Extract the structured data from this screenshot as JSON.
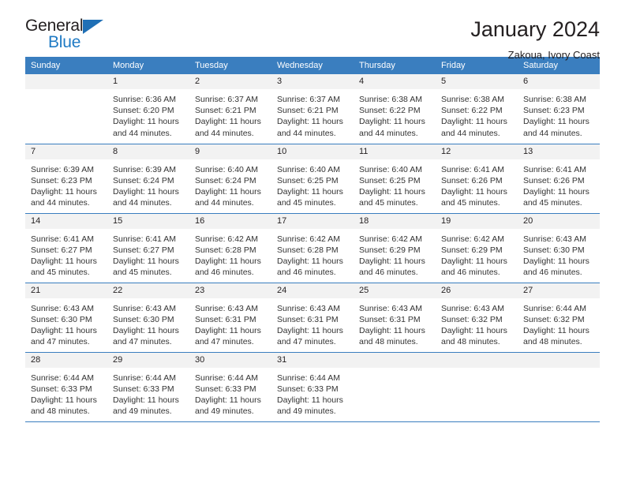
{
  "brand": {
    "name_part1": "General",
    "name_part2": "Blue",
    "triangle_color": "#1f6fb5",
    "blue_color": "#1f7ac4"
  },
  "header": {
    "title": "January 2024",
    "subtitle": "Zakoua, Ivory Coast"
  },
  "theme": {
    "header_row_bg": "#3a7ebf",
    "daynum_bg": "#f2f2f2",
    "row_border": "#3a7ebf",
    "text": "#231f20"
  },
  "weekday_headers": [
    "Sunday",
    "Monday",
    "Tuesday",
    "Wednesday",
    "Thursday",
    "Friday",
    "Saturday"
  ],
  "weeks": [
    [
      {
        "day": "",
        "sunrise": "",
        "sunset": "",
        "daylight_line1": "",
        "daylight_line2": ""
      },
      {
        "day": "1",
        "sunrise": "Sunrise: 6:36 AM",
        "sunset": "Sunset: 6:20 PM",
        "daylight_line1": "Daylight: 11 hours",
        "daylight_line2": "and 44 minutes."
      },
      {
        "day": "2",
        "sunrise": "Sunrise: 6:37 AM",
        "sunset": "Sunset: 6:21 PM",
        "daylight_line1": "Daylight: 11 hours",
        "daylight_line2": "and 44 minutes."
      },
      {
        "day": "3",
        "sunrise": "Sunrise: 6:37 AM",
        "sunset": "Sunset: 6:21 PM",
        "daylight_line1": "Daylight: 11 hours",
        "daylight_line2": "and 44 minutes."
      },
      {
        "day": "4",
        "sunrise": "Sunrise: 6:38 AM",
        "sunset": "Sunset: 6:22 PM",
        "daylight_line1": "Daylight: 11 hours",
        "daylight_line2": "and 44 minutes."
      },
      {
        "day": "5",
        "sunrise": "Sunrise: 6:38 AM",
        "sunset": "Sunset: 6:22 PM",
        "daylight_line1": "Daylight: 11 hours",
        "daylight_line2": "and 44 minutes."
      },
      {
        "day": "6",
        "sunrise": "Sunrise: 6:38 AM",
        "sunset": "Sunset: 6:23 PM",
        "daylight_line1": "Daylight: 11 hours",
        "daylight_line2": "and 44 minutes."
      }
    ],
    [
      {
        "day": "7",
        "sunrise": "Sunrise: 6:39 AM",
        "sunset": "Sunset: 6:23 PM",
        "daylight_line1": "Daylight: 11 hours",
        "daylight_line2": "and 44 minutes."
      },
      {
        "day": "8",
        "sunrise": "Sunrise: 6:39 AM",
        "sunset": "Sunset: 6:24 PM",
        "daylight_line1": "Daylight: 11 hours",
        "daylight_line2": "and 44 minutes."
      },
      {
        "day": "9",
        "sunrise": "Sunrise: 6:40 AM",
        "sunset": "Sunset: 6:24 PM",
        "daylight_line1": "Daylight: 11 hours",
        "daylight_line2": "and 44 minutes."
      },
      {
        "day": "10",
        "sunrise": "Sunrise: 6:40 AM",
        "sunset": "Sunset: 6:25 PM",
        "daylight_line1": "Daylight: 11 hours",
        "daylight_line2": "and 45 minutes."
      },
      {
        "day": "11",
        "sunrise": "Sunrise: 6:40 AM",
        "sunset": "Sunset: 6:25 PM",
        "daylight_line1": "Daylight: 11 hours",
        "daylight_line2": "and 45 minutes."
      },
      {
        "day": "12",
        "sunrise": "Sunrise: 6:41 AM",
        "sunset": "Sunset: 6:26 PM",
        "daylight_line1": "Daylight: 11 hours",
        "daylight_line2": "and 45 minutes."
      },
      {
        "day": "13",
        "sunrise": "Sunrise: 6:41 AM",
        "sunset": "Sunset: 6:26 PM",
        "daylight_line1": "Daylight: 11 hours",
        "daylight_line2": "and 45 minutes."
      }
    ],
    [
      {
        "day": "14",
        "sunrise": "Sunrise: 6:41 AM",
        "sunset": "Sunset: 6:27 PM",
        "daylight_line1": "Daylight: 11 hours",
        "daylight_line2": "and 45 minutes."
      },
      {
        "day": "15",
        "sunrise": "Sunrise: 6:41 AM",
        "sunset": "Sunset: 6:27 PM",
        "daylight_line1": "Daylight: 11 hours",
        "daylight_line2": "and 45 minutes."
      },
      {
        "day": "16",
        "sunrise": "Sunrise: 6:42 AM",
        "sunset": "Sunset: 6:28 PM",
        "daylight_line1": "Daylight: 11 hours",
        "daylight_line2": "and 46 minutes."
      },
      {
        "day": "17",
        "sunrise": "Sunrise: 6:42 AM",
        "sunset": "Sunset: 6:28 PM",
        "daylight_line1": "Daylight: 11 hours",
        "daylight_line2": "and 46 minutes."
      },
      {
        "day": "18",
        "sunrise": "Sunrise: 6:42 AM",
        "sunset": "Sunset: 6:29 PM",
        "daylight_line1": "Daylight: 11 hours",
        "daylight_line2": "and 46 minutes."
      },
      {
        "day": "19",
        "sunrise": "Sunrise: 6:42 AM",
        "sunset": "Sunset: 6:29 PM",
        "daylight_line1": "Daylight: 11 hours",
        "daylight_line2": "and 46 minutes."
      },
      {
        "day": "20",
        "sunrise": "Sunrise: 6:43 AM",
        "sunset": "Sunset: 6:30 PM",
        "daylight_line1": "Daylight: 11 hours",
        "daylight_line2": "and 46 minutes."
      }
    ],
    [
      {
        "day": "21",
        "sunrise": "Sunrise: 6:43 AM",
        "sunset": "Sunset: 6:30 PM",
        "daylight_line1": "Daylight: 11 hours",
        "daylight_line2": "and 47 minutes."
      },
      {
        "day": "22",
        "sunrise": "Sunrise: 6:43 AM",
        "sunset": "Sunset: 6:30 PM",
        "daylight_line1": "Daylight: 11 hours",
        "daylight_line2": "and 47 minutes."
      },
      {
        "day": "23",
        "sunrise": "Sunrise: 6:43 AM",
        "sunset": "Sunset: 6:31 PM",
        "daylight_line1": "Daylight: 11 hours",
        "daylight_line2": "and 47 minutes."
      },
      {
        "day": "24",
        "sunrise": "Sunrise: 6:43 AM",
        "sunset": "Sunset: 6:31 PM",
        "daylight_line1": "Daylight: 11 hours",
        "daylight_line2": "and 47 minutes."
      },
      {
        "day": "25",
        "sunrise": "Sunrise: 6:43 AM",
        "sunset": "Sunset: 6:31 PM",
        "daylight_line1": "Daylight: 11 hours",
        "daylight_line2": "and 48 minutes."
      },
      {
        "day": "26",
        "sunrise": "Sunrise: 6:43 AM",
        "sunset": "Sunset: 6:32 PM",
        "daylight_line1": "Daylight: 11 hours",
        "daylight_line2": "and 48 minutes."
      },
      {
        "day": "27",
        "sunrise": "Sunrise: 6:44 AM",
        "sunset": "Sunset: 6:32 PM",
        "daylight_line1": "Daylight: 11 hours",
        "daylight_line2": "and 48 minutes."
      }
    ],
    [
      {
        "day": "28",
        "sunrise": "Sunrise: 6:44 AM",
        "sunset": "Sunset: 6:33 PM",
        "daylight_line1": "Daylight: 11 hours",
        "daylight_line2": "and 48 minutes."
      },
      {
        "day": "29",
        "sunrise": "Sunrise: 6:44 AM",
        "sunset": "Sunset: 6:33 PM",
        "daylight_line1": "Daylight: 11 hours",
        "daylight_line2": "and 49 minutes."
      },
      {
        "day": "30",
        "sunrise": "Sunrise: 6:44 AM",
        "sunset": "Sunset: 6:33 PM",
        "daylight_line1": "Daylight: 11 hours",
        "daylight_line2": "and 49 minutes."
      },
      {
        "day": "31",
        "sunrise": "Sunrise: 6:44 AM",
        "sunset": "Sunset: 6:33 PM",
        "daylight_line1": "Daylight: 11 hours",
        "daylight_line2": "and 49 minutes."
      },
      {
        "day": "",
        "sunrise": "",
        "sunset": "",
        "daylight_line1": "",
        "daylight_line2": ""
      },
      {
        "day": "",
        "sunrise": "",
        "sunset": "",
        "daylight_line1": "",
        "daylight_line2": ""
      },
      {
        "day": "",
        "sunrise": "",
        "sunset": "",
        "daylight_line1": "",
        "daylight_line2": ""
      }
    ]
  ]
}
